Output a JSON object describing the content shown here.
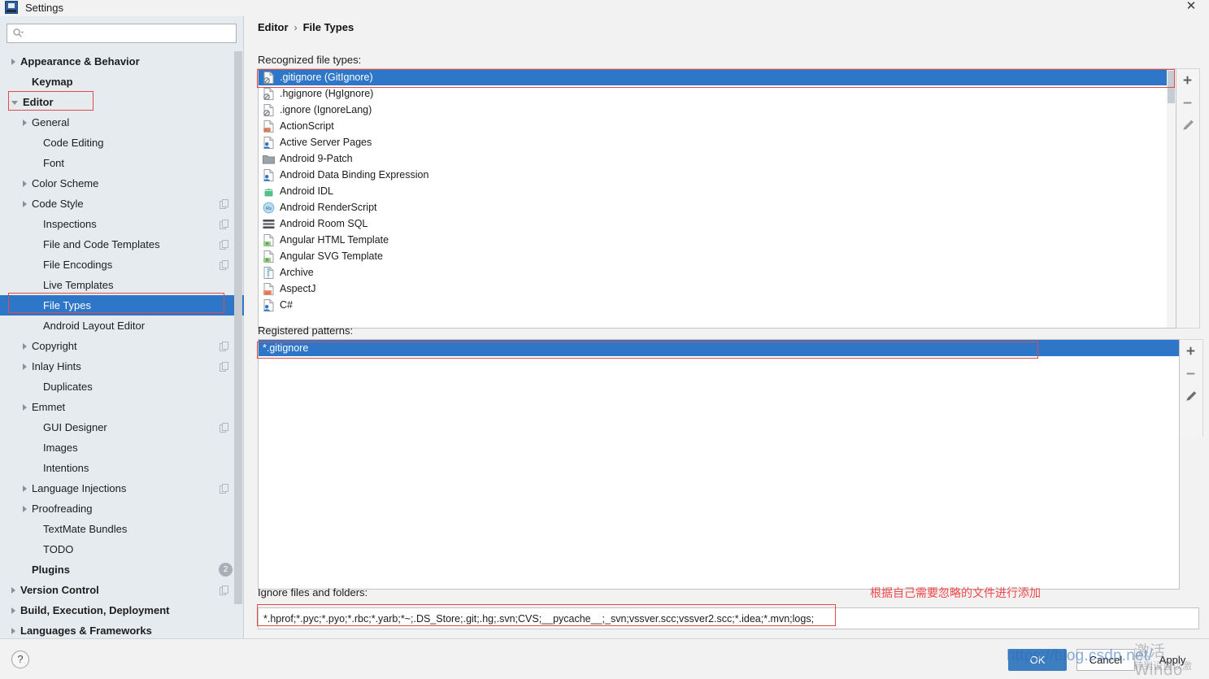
{
  "window": {
    "title": "Settings",
    "app_icon": "intellij-idea-icon",
    "close_label": "✕"
  },
  "search": {
    "value": "",
    "placeholder": "",
    "icon": "search-icon"
  },
  "sidebar": {
    "items": [
      {
        "label": "Appearance & Behavior",
        "indent": 0,
        "arrow": "right",
        "bold": true,
        "badge": "",
        "selected": false
      },
      {
        "label": "Keymap",
        "indent": 1,
        "arrow": "none",
        "bold": true,
        "badge": "",
        "selected": false
      },
      {
        "label": "Editor",
        "indent": 0,
        "arrow": "down",
        "bold": true,
        "badge": "",
        "selected": false,
        "outlined": true
      },
      {
        "label": "General",
        "indent": 1,
        "arrow": "right",
        "bold": false,
        "badge": "",
        "selected": false
      },
      {
        "label": "Code Editing",
        "indent": 2,
        "arrow": "none",
        "bold": false,
        "badge": "",
        "selected": false
      },
      {
        "label": "Font",
        "indent": 2,
        "arrow": "none",
        "bold": false,
        "badge": "",
        "selected": false
      },
      {
        "label": "Color Scheme",
        "indent": 1,
        "arrow": "right",
        "bold": false,
        "badge": "",
        "selected": false
      },
      {
        "label": "Code Style",
        "indent": 1,
        "arrow": "right",
        "bold": false,
        "badge": "copy",
        "selected": false
      },
      {
        "label": "Inspections",
        "indent": 2,
        "arrow": "none",
        "bold": false,
        "badge": "copy",
        "selected": false
      },
      {
        "label": "File and Code Templates",
        "indent": 2,
        "arrow": "none",
        "bold": false,
        "badge": "copy",
        "selected": false
      },
      {
        "label": "File Encodings",
        "indent": 2,
        "arrow": "none",
        "bold": false,
        "badge": "copy",
        "selected": false
      },
      {
        "label": "Live Templates",
        "indent": 2,
        "arrow": "none",
        "bold": false,
        "badge": "",
        "selected": false
      },
      {
        "label": "File Types",
        "indent": 2,
        "arrow": "none",
        "bold": false,
        "badge": "",
        "selected": true,
        "outlined": true
      },
      {
        "label": "Android Layout Editor",
        "indent": 2,
        "arrow": "none",
        "bold": false,
        "badge": "",
        "selected": false
      },
      {
        "label": "Copyright",
        "indent": 1,
        "arrow": "right",
        "bold": false,
        "badge": "copy",
        "selected": false
      },
      {
        "label": "Inlay Hints",
        "indent": 1,
        "arrow": "right",
        "bold": false,
        "badge": "copy",
        "selected": false
      },
      {
        "label": "Duplicates",
        "indent": 2,
        "arrow": "none",
        "bold": false,
        "badge": "",
        "selected": false
      },
      {
        "label": "Emmet",
        "indent": 1,
        "arrow": "right",
        "bold": false,
        "badge": "",
        "selected": false
      },
      {
        "label": "GUI Designer",
        "indent": 2,
        "arrow": "none",
        "bold": false,
        "badge": "copy",
        "selected": false
      },
      {
        "label": "Images",
        "indent": 2,
        "arrow": "none",
        "bold": false,
        "badge": "",
        "selected": false
      },
      {
        "label": "Intentions",
        "indent": 2,
        "arrow": "none",
        "bold": false,
        "badge": "",
        "selected": false
      },
      {
        "label": "Language Injections",
        "indent": 1,
        "arrow": "right",
        "bold": false,
        "badge": "copy",
        "selected": false
      },
      {
        "label": "Proofreading",
        "indent": 1,
        "arrow": "right",
        "bold": false,
        "badge": "",
        "selected": false
      },
      {
        "label": "TextMate Bundles",
        "indent": 2,
        "arrow": "none",
        "bold": false,
        "badge": "",
        "selected": false
      },
      {
        "label": "TODO",
        "indent": 2,
        "arrow": "none",
        "bold": false,
        "badge": "",
        "selected": false
      },
      {
        "label": "Plugins",
        "indent": 1,
        "arrow": "none",
        "bold": true,
        "badge": "2",
        "selected": false
      },
      {
        "label": "Version Control",
        "indent": 0,
        "arrow": "right",
        "bold": true,
        "badge": "copy",
        "selected": false
      },
      {
        "label": "Build, Execution, Deployment",
        "indent": 0,
        "arrow": "right",
        "bold": true,
        "badge": "",
        "selected": false
      },
      {
        "label": "Languages & Frameworks",
        "indent": 0,
        "arrow": "right",
        "bold": true,
        "badge": "",
        "selected": false
      }
    ]
  },
  "breadcrumb": {
    "root": "Editor",
    "separator": "›",
    "current": "File Types"
  },
  "main": {
    "recognized_label": "Recognized file types:",
    "patterns_label": "Registered patterns:",
    "ignore_label": "Ignore files and folders:",
    "file_types": [
      {
        "name": ".gitignore (GitIgnore)",
        "icon": "ignore-file-icon",
        "selected": true
      },
      {
        "name": ".hgignore (HgIgnore)",
        "icon": "ignore-file-icon",
        "selected": false
      },
      {
        "name": ".ignore (IgnoreLang)",
        "icon": "ignore-file-icon",
        "selected": false
      },
      {
        "name": "ActionScript",
        "icon": "actionscript-icon",
        "selected": false
      },
      {
        "name": "Active Server Pages",
        "icon": "asp-icon",
        "selected": false
      },
      {
        "name": "Android 9-Patch",
        "icon": "folder-icon",
        "selected": false
      },
      {
        "name": "Android Data Binding Expression",
        "icon": "asp-icon",
        "selected": false
      },
      {
        "name": "Android IDL",
        "icon": "android-icon",
        "selected": false
      },
      {
        "name": "Android RenderScript",
        "icon": "renderscript-icon",
        "selected": false
      },
      {
        "name": "Android Room SQL",
        "icon": "sql-icon",
        "selected": false
      },
      {
        "name": "Angular HTML Template",
        "icon": "angular-html-icon",
        "selected": false
      },
      {
        "name": "Angular SVG Template",
        "icon": "angular-html-icon",
        "selected": false
      },
      {
        "name": "Archive",
        "icon": "archive-icon",
        "selected": false
      },
      {
        "name": "AspectJ",
        "icon": "aspectj-icon",
        "selected": false
      },
      {
        "name": "C#",
        "icon": "csharp-icon",
        "selected": false
      }
    ],
    "patterns": [
      {
        "value": "*.gitignore",
        "selected": true
      }
    ],
    "ignore_value": "*.hprof;*.pyc;*.pyo;*.rbc;*.yarb;*~;.DS_Store;.git;.hg;.svn;CVS;__pycache__;_svn;vssver.scc;vssver2.scc;*.idea;*.mvn;logs;",
    "tools": {
      "add": "add-icon",
      "remove": "remove-icon",
      "edit": "edit-icon"
    }
  },
  "annotation": {
    "text": "根据自己需要忽略的文件进行添加",
    "color": "#f1484a"
  },
  "footer": {
    "help": "?",
    "ok": "OK",
    "cancel": "Cancel",
    "apply": "Apply"
  },
  "watermarks": {
    "url": "https://blog.csdn.net/",
    "activate_line1": "激活 Windo",
    "activate_line2": "转到设置以激"
  },
  "colors": {
    "selection_blue": "#2d76c8",
    "annotation_red": "#e04a4a",
    "primary_button": "#3c7ebf",
    "sidebar_bg": "#e6ebef"
  }
}
